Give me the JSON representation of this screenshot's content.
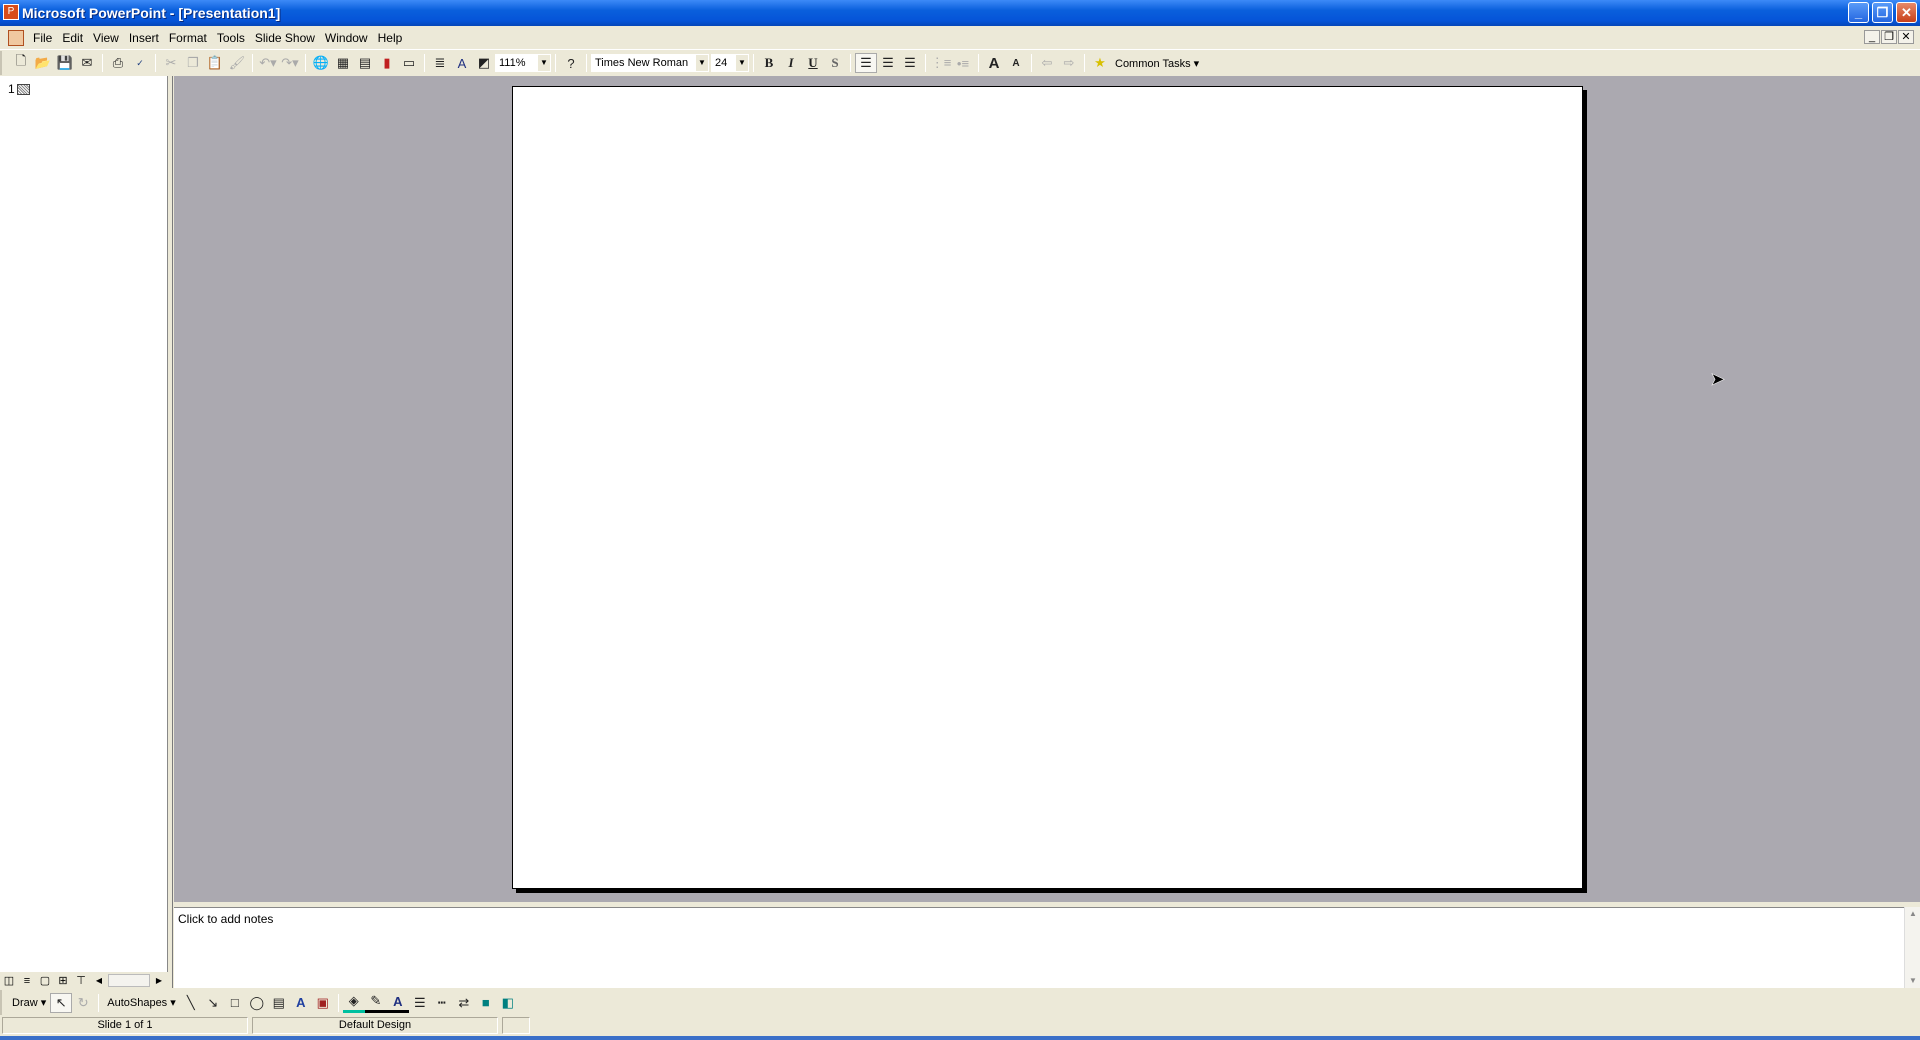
{
  "window": {
    "title": "Microsoft PowerPoint - [Presentation1]",
    "app_icon": "powerpoint-icon",
    "controls": {
      "minimize": "_",
      "restore": "❐",
      "close": "✕"
    },
    "doc_controls": {
      "minimize": "_",
      "restore": "❐",
      "close": "✕"
    }
  },
  "menu": {
    "items": [
      "File",
      "Edit",
      "View",
      "Insert",
      "Format",
      "Tools",
      "Slide Show",
      "Window",
      "Help"
    ]
  },
  "toolbar": {
    "zoom": "111%",
    "font": "Times New Roman",
    "font_size": "24",
    "bold": "B",
    "italic": "I",
    "underline": "U",
    "shadow": "S",
    "common_tasks": "Common Tasks ▾"
  },
  "outline": {
    "slide_number": "1"
  },
  "notes": {
    "placeholder": "Click to add notes"
  },
  "drawing": {
    "draw": "Draw ▾",
    "autoshapes": "AutoShapes ▾"
  },
  "status": {
    "slide": "Slide 1 of 1",
    "design": "Default Design"
  },
  "colors": {
    "titlebar": "#0554d8",
    "workspace": "#aba9b0",
    "chrome": "#ece9d8"
  }
}
